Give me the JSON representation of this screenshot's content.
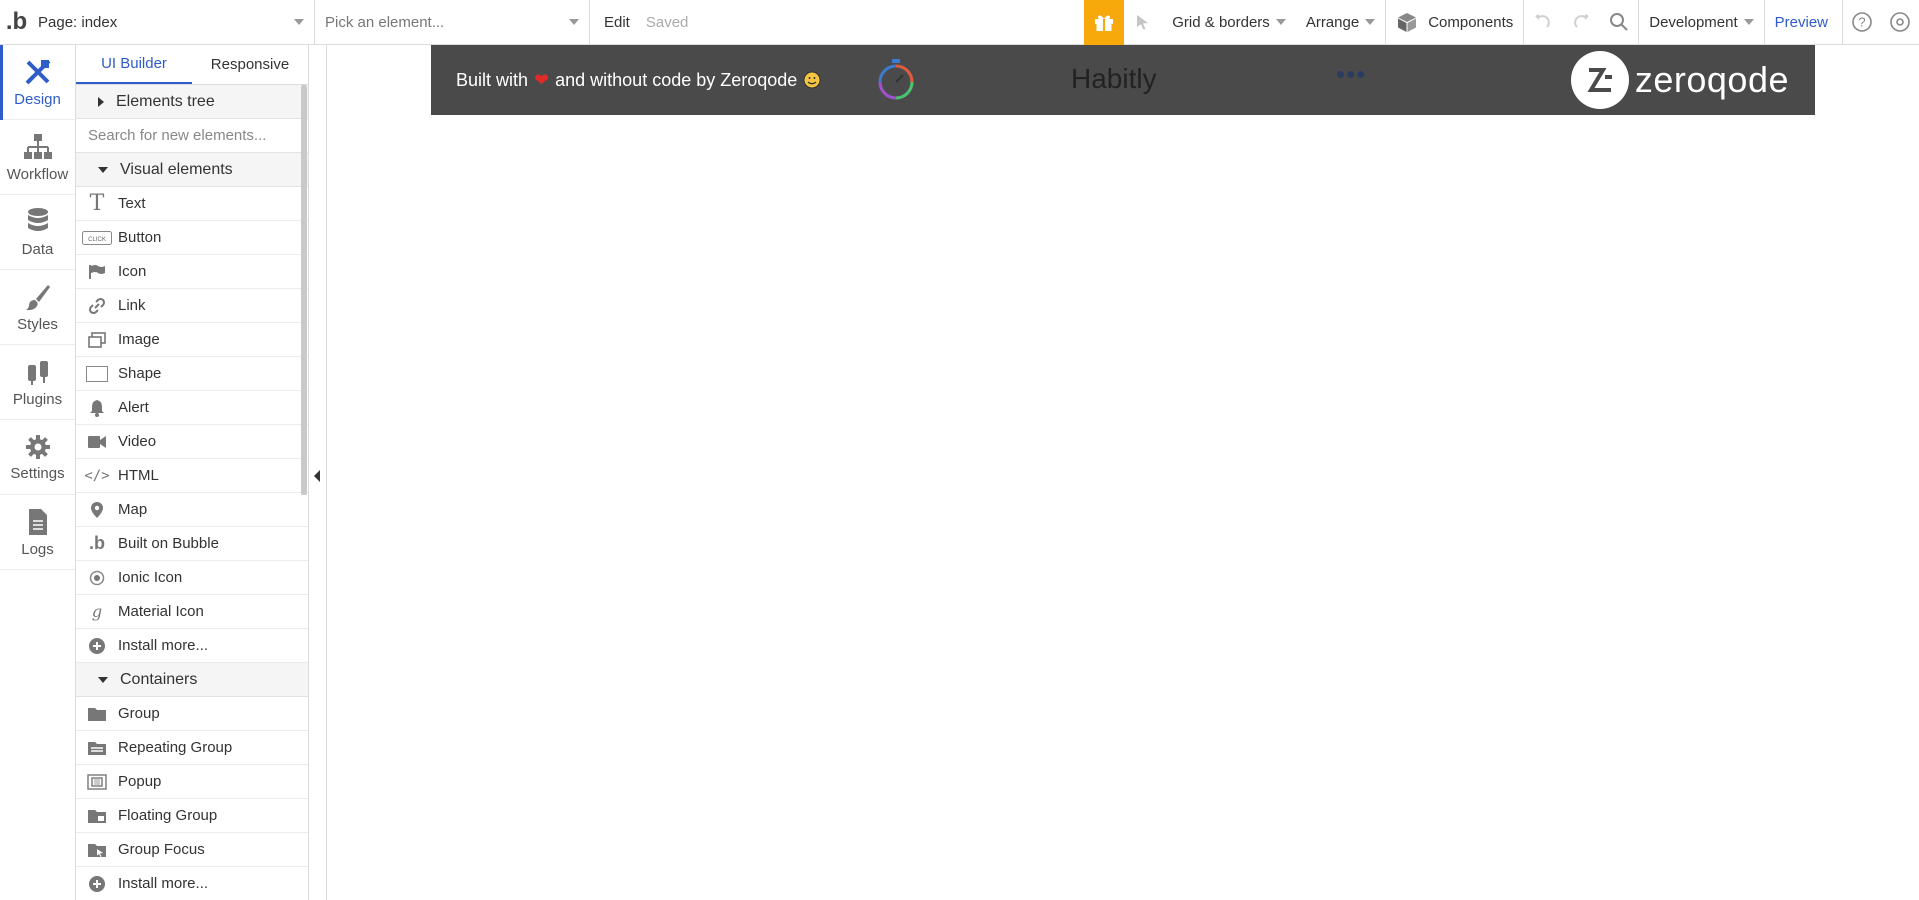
{
  "topbar": {
    "logo": ".b",
    "page_label": "Page: index",
    "element_placeholder": "Pick an element...",
    "edit_label": "Edit",
    "saved_label": "Saved",
    "grid_label": "Grid & borders",
    "arrange_label": "Arrange",
    "components_label": "Components",
    "development_label": "Development",
    "preview_label": "Preview",
    "gift_color": "#f7a90b",
    "accent": "#2e5cc9"
  },
  "rail": {
    "items": [
      {
        "label": "Design",
        "icon": "design-icon"
      },
      {
        "label": "Workflow",
        "icon": "workflow-icon"
      },
      {
        "label": "Data",
        "icon": "database-icon"
      },
      {
        "label": "Styles",
        "icon": "brush-icon"
      },
      {
        "label": "Plugins",
        "icon": "plug-icon"
      },
      {
        "label": "Settings",
        "icon": "gear-icon"
      },
      {
        "label": "Logs",
        "icon": "document-icon"
      }
    ]
  },
  "palette": {
    "tabs": [
      "UI Builder",
      "Responsive"
    ],
    "elements_tree": "Elements tree",
    "search_placeholder": "Search for new elements...",
    "visual_section": "Visual elements",
    "visual_items": [
      {
        "label": "Text",
        "icon": "text-icon"
      },
      {
        "label": "Button",
        "icon": "button-icon"
      },
      {
        "label": "Icon",
        "icon": "flag-icon"
      },
      {
        "label": "Link",
        "icon": "link-icon"
      },
      {
        "label": "Image",
        "icon": "image-icon"
      },
      {
        "label": "Shape",
        "icon": "shape-icon"
      },
      {
        "label": "Alert",
        "icon": "bell-icon"
      },
      {
        "label": "Video",
        "icon": "video-icon"
      },
      {
        "label": "HTML",
        "icon": "code-icon"
      },
      {
        "label": "Map",
        "icon": "map-pin-icon"
      },
      {
        "label": "Built on Bubble",
        "icon": "bubble-icon"
      },
      {
        "label": "Ionic Icon",
        "icon": "ionic-icon"
      },
      {
        "label": "Material Icon",
        "icon": "material-icon"
      },
      {
        "label": "Install more...",
        "icon": "plus-circle-icon"
      }
    ],
    "containers_section": "Containers",
    "container_items": [
      {
        "label": "Group",
        "icon": "folder-icon"
      },
      {
        "label": "Repeating Group",
        "icon": "repeating-group-icon"
      },
      {
        "label": "Popup",
        "icon": "popup-icon"
      },
      {
        "label": "Floating Group",
        "icon": "floating-group-icon"
      },
      {
        "label": "Group Focus",
        "icon": "group-focus-icon"
      },
      {
        "label": "Install more...",
        "icon": "plus-circle-icon"
      }
    ]
  },
  "canvas": {
    "built_with": "Built with",
    "built_rest": "and without code by Zeroqode",
    "app_name": "Habitly",
    "dots": "•••",
    "brand": "zeroqode",
    "header_color": "#4a4a4a"
  }
}
